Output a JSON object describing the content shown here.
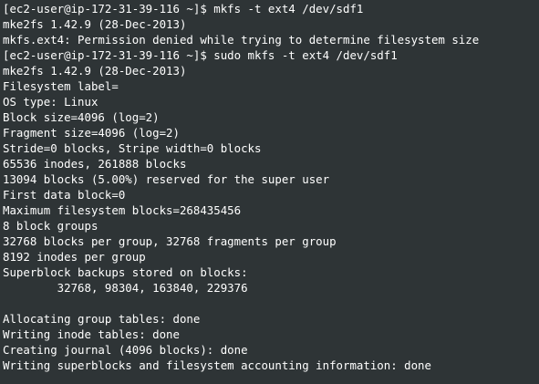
{
  "terminal": {
    "background_color": "#2e3436",
    "text_color": "#ffffff",
    "lines": [
      "[ec2-user@ip-172-31-39-116 ~]$ mkfs -t ext4 /dev/sdf1",
      "mke2fs 1.42.9 (28-Dec-2013)",
      "mkfs.ext4: Permission denied while trying to determine filesystem size",
      "[ec2-user@ip-172-31-39-116 ~]$ sudo mkfs -t ext4 /dev/sdf1",
      "mke2fs 1.42.9 (28-Dec-2013)",
      "Filesystem label=",
      "OS type: Linux",
      "Block size=4096 (log=2)",
      "Fragment size=4096 (log=2)",
      "Stride=0 blocks, Stripe width=0 blocks",
      "65536 inodes, 261888 blocks",
      "13094 blocks (5.00%) reserved for the super user",
      "First data block=0",
      "Maximum filesystem blocks=268435456",
      "8 block groups",
      "32768 blocks per group, 32768 fragments per group",
      "8192 inodes per group",
      "Superblock backups stored on blocks:",
      "        32768, 98304, 163840, 229376",
      "",
      "Allocating group tables: done",
      "Writing inode tables: done",
      "Creating journal (4096 blocks): done",
      "Writing superblocks and filesystem accounting information: done"
    ]
  }
}
